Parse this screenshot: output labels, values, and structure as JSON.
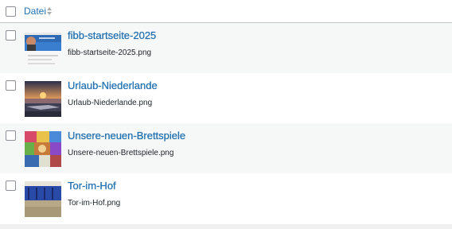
{
  "header": {
    "column_label": "Datei"
  },
  "icons": {
    "sort": "sort-arrows-icon",
    "checkbox": "checkbox-icon"
  },
  "colors": {
    "link": "#2271b1",
    "row_alt": "#f6f7f7",
    "border": "#c3c4c7"
  },
  "rows": [
    {
      "title": "fibb-startseite-2025",
      "filename": "fibb-startseite-2025.png"
    },
    {
      "title": "Urlaub-Niederlande",
      "filename": "Urlaub-Niederlande.png"
    },
    {
      "title": "Unsere-neuen-Brettspiele",
      "filename": "Unsere-neuen-Brettspiele.png"
    },
    {
      "title": "Tor-im-Hof",
      "filename": "Tor-im-Hof.png"
    }
  ]
}
